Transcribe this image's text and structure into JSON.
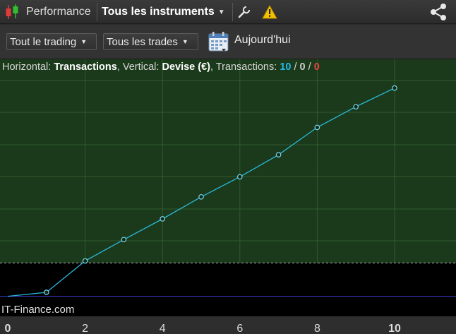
{
  "toolbar": {
    "title": "Performance",
    "instrument": "Tous les instruments",
    "icons": [
      "candlestick-icon",
      "wrench-icon",
      "warning-icon",
      "share-icon"
    ],
    "colors": {
      "candle_up": "#2fbf2f",
      "candle_down": "#e03a3a",
      "warning": "#f2c200"
    }
  },
  "filters": {
    "trading": "Tout le trading",
    "trades": "Tous les trades",
    "date_label": "Aujourd'hui"
  },
  "legend": {
    "h_prefix": "Horizontal: ",
    "h_value": "Transactions",
    "v_prefix": ", Vertical: ",
    "v_value": "Devise (€)",
    "t_prefix": ", Transactions: ",
    "total": "10",
    "sep1": " / ",
    "wins": "0",
    "sep2": " / ",
    "losses": "0"
  },
  "watermark": "IT-Finance.com",
  "chart_data": {
    "type": "line",
    "title": "",
    "xlabel": "Transactions",
    "ylabel": "Devise (€)",
    "x": [
      0,
      1,
      2,
      3,
      4,
      5,
      6,
      7,
      8,
      9,
      10
    ],
    "y": [
      0.0,
      0.6,
      5.3,
      8.5,
      11.6,
      14.9,
      17.9,
      21.2,
      25.3,
      28.4,
      31.2
    ],
    "xticks": [
      "0",
      "2",
      "4",
      "6",
      "8",
      "10"
    ],
    "xlim": [
      0,
      11.6
    ],
    "ylim": [
      -3.0,
      35.5
    ],
    "reference_level": 5.0,
    "grid": true,
    "colors": {
      "positive_bg": "#1b3a1b",
      "negative_bg": "#000000",
      "line": "#2ab8dc",
      "zero_line": "#3a3acc",
      "reference_line": "#b8b8b8"
    }
  }
}
